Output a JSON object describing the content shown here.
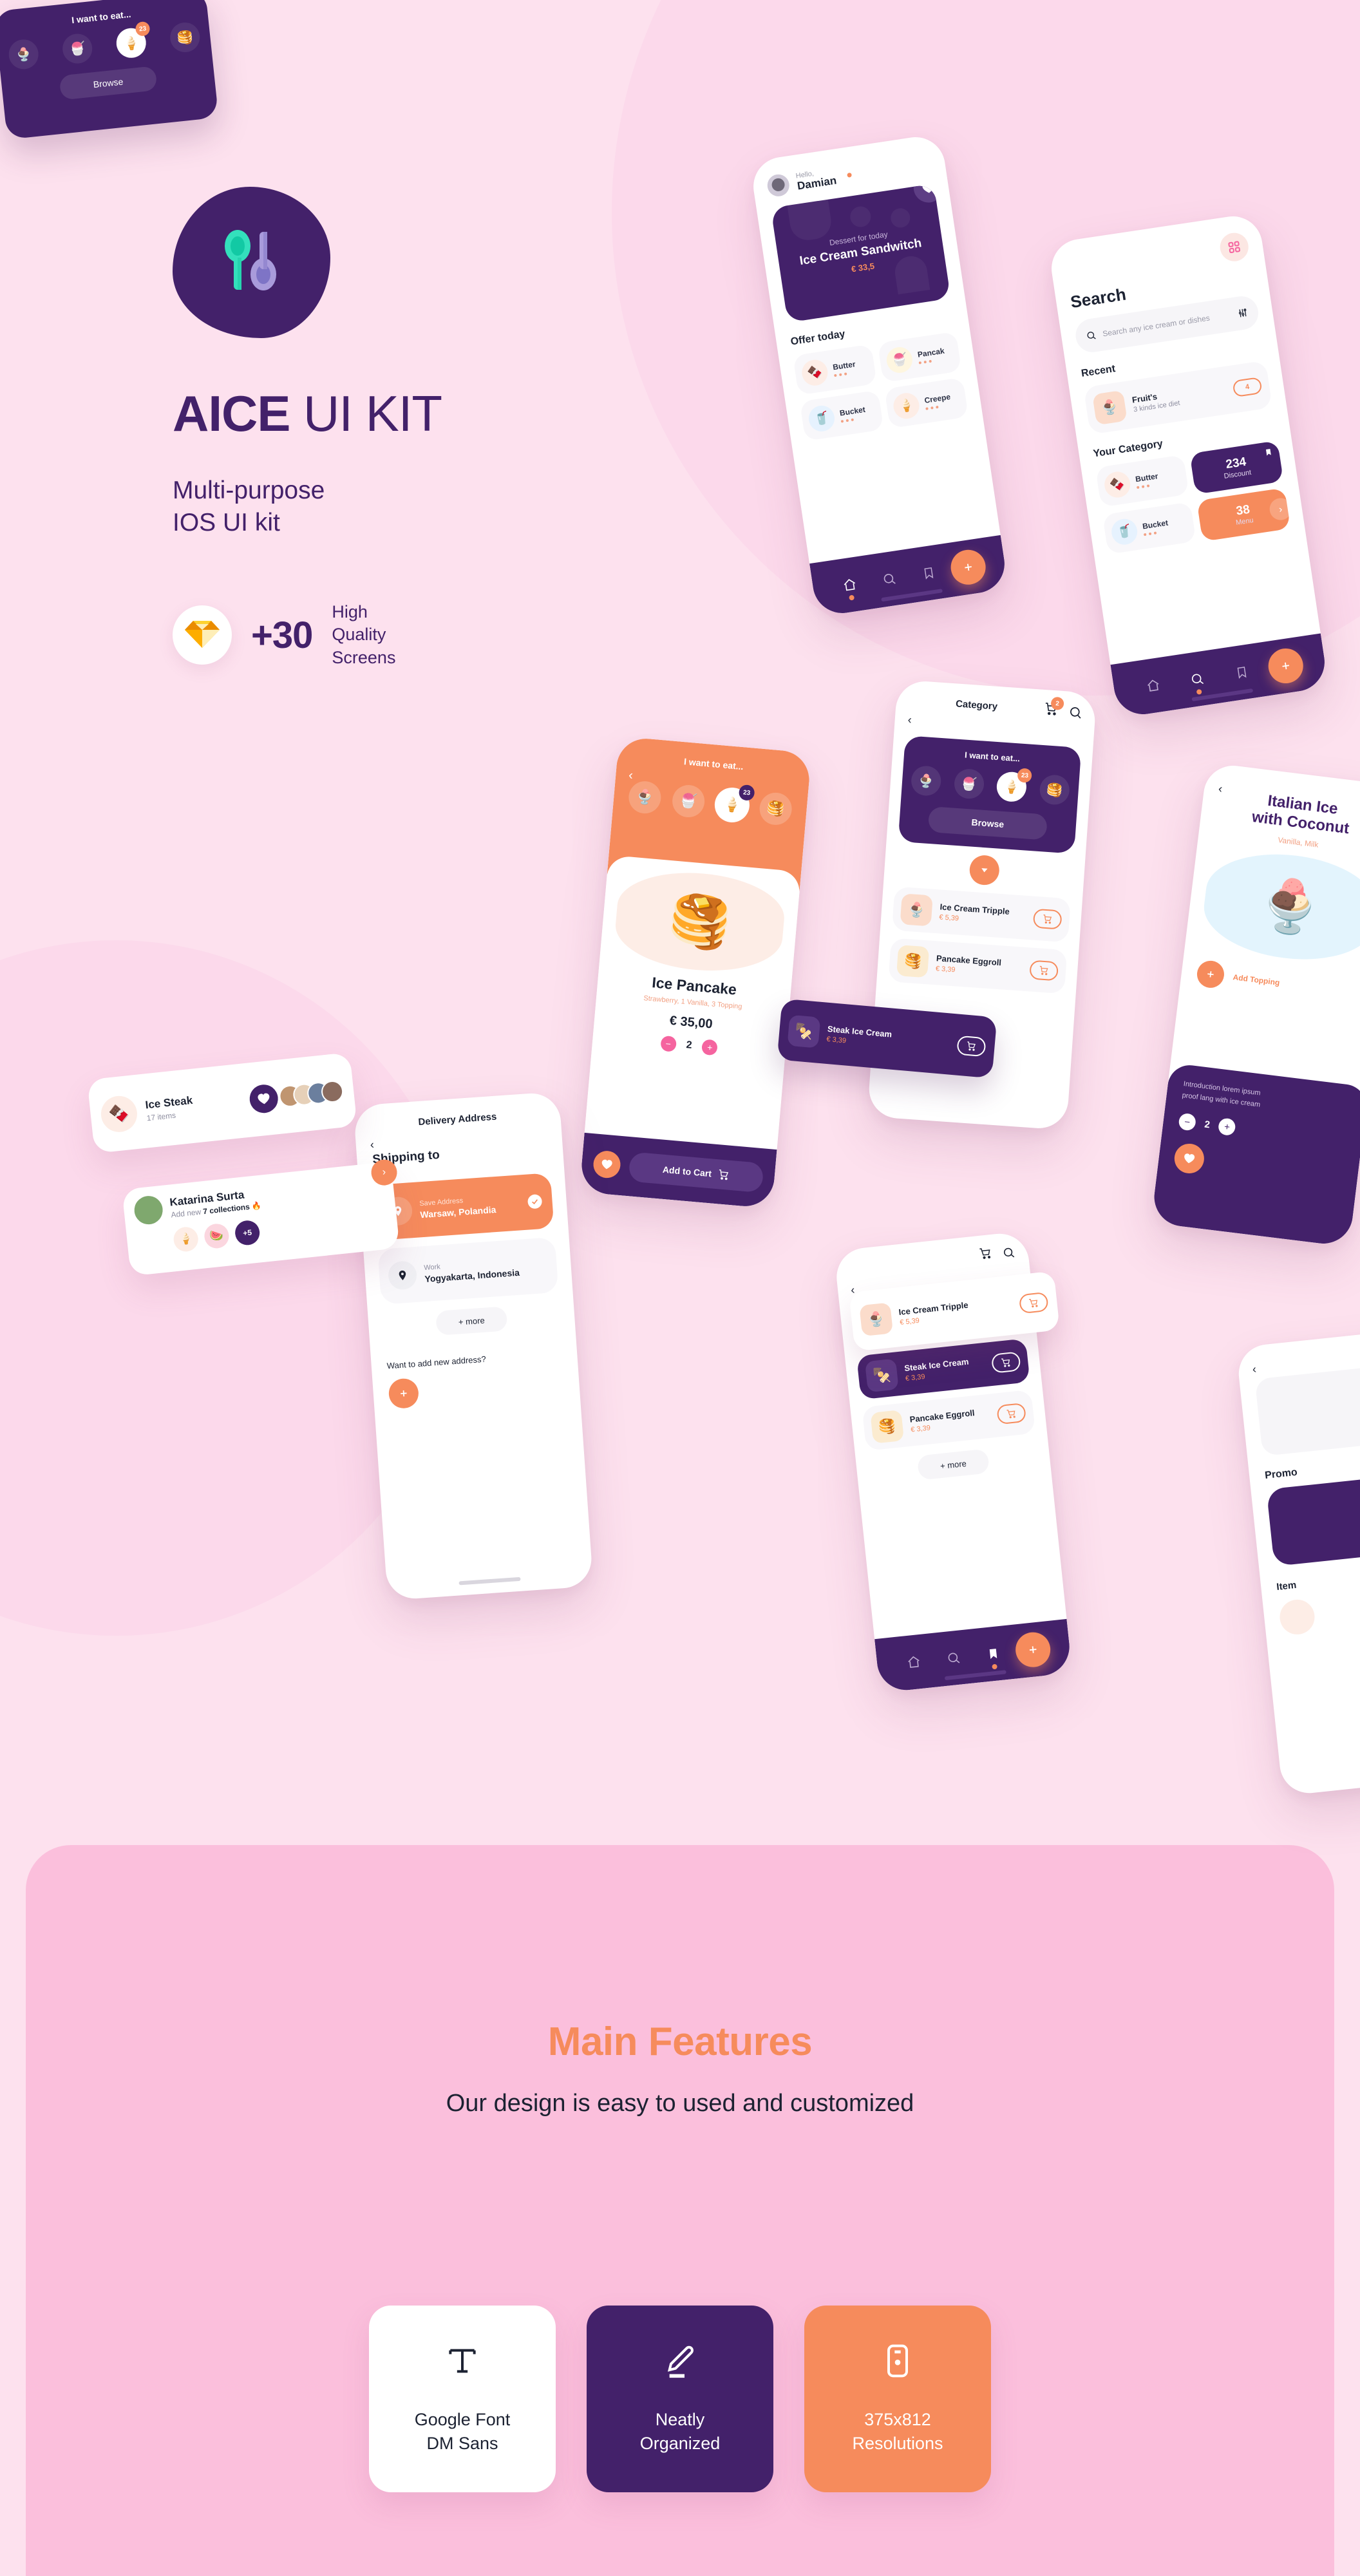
{
  "brand": {
    "title_bold": "AICE",
    "title_rest": " UI KIT",
    "subtitle_line1": "Multi-purpose",
    "subtitle_line2": "IOS UI kit",
    "count": "+30",
    "count_caption_line1": "High",
    "count_caption_line2": "Quality",
    "count_caption_line3": "Screens",
    "logo_icon": "two-spoons-icon",
    "sketch_icon": "sketch-diamond-icon",
    "colors": {
      "purple": "#43216A",
      "orange": "#F68B5C",
      "pink_bg": "#FDE1EE",
      "pink_panel": "#FBBFDC",
      "dark_text": "#1C2232"
    }
  },
  "home_screen": {
    "greeting": "Hello,",
    "user_name": "Damian",
    "hero_label": "Dessert for today",
    "hero_name": "Ice Cream Sandwitch",
    "hero_price": "€ 33,5",
    "section_title": "Offer today",
    "offers": [
      {
        "name": "Butter",
        "emoji": "🍫"
      },
      {
        "name": "Pancak",
        "emoji": "🍧"
      },
      {
        "name": "Bucket",
        "emoji": "🥤"
      },
      {
        "name": "Creepe",
        "emoji": "🍦"
      }
    ],
    "nav": [
      "home-icon",
      "search-icon",
      "bookmark-icon",
      "add-fab-icon"
    ]
  },
  "search_screen": {
    "title": "Search",
    "placeholder": "Search any ice cream or dishes",
    "recent_title": "Recent",
    "recent_item": {
      "name": "Fruit's",
      "desc": "3 kinds ice diet",
      "count": "4",
      "emoji": "🍨"
    },
    "category_title": "Your Category",
    "categories": [
      {
        "name": "Butter",
        "emoji": "🍫"
      },
      {
        "name": "Bucket",
        "emoji": "🥤"
      }
    ],
    "stats": [
      {
        "num": "234",
        "label": "Discount"
      },
      {
        "num": "38",
        "label": "Menu"
      }
    ]
  },
  "detail_screen": {
    "header": "I want to eat...",
    "chips": [
      "🍨",
      "🍧",
      "🍦",
      "🥞"
    ],
    "chip_badge": "23",
    "product_name": "Ice Pancake",
    "product_sub": "Strawberry, 1 Vanilla, 3 Topping",
    "price": "€ 35,00",
    "qty": "2",
    "add_to_cart": "Add to Cart"
  },
  "category_screen": {
    "title": "Category",
    "cart_badge": "2",
    "panel_title": "I want to eat...",
    "chip_badge": "23",
    "browse": "Browse",
    "items": [
      {
        "name": "Ice Cream Tripple",
        "price": "€ 5,39",
        "emoji": "🍨"
      },
      {
        "name": "Pancake Eggroll",
        "price": "€ 3,39",
        "emoji": "🥞"
      }
    ]
  },
  "italian_screen": {
    "title_line1": "Italian Ice",
    "title_line2": "with Coconut",
    "subtitle": "Vanilla, Milk",
    "add_topping": "Add Topping",
    "intro_line1": "Introduction lorem ipsum",
    "intro_line2": "proof lang with ice cream",
    "qty": "2"
  },
  "cart_screen": {
    "items": [
      {
        "name": "Ice Cream Tripple",
        "price": "€ 5,39",
        "emoji": "🍨",
        "dark": false
      },
      {
        "name": "Steak Ice Cream",
        "price": "€ 3,39",
        "emoji": "🍢",
        "dark": true
      },
      {
        "name": "Pancake Eggroll",
        "price": "€ 3,39",
        "emoji": "🥞",
        "dark": false
      }
    ],
    "more": "+ more"
  },
  "promo_screen": {
    "promo_label": "Promo",
    "item_label": "Item"
  },
  "delivery_screen": {
    "title": "Delivery Address",
    "shipping_to": "Shipping to",
    "addresses": [
      {
        "label": "Save Address",
        "value": "Warsaw, Polandia",
        "selected": true
      },
      {
        "label": "Work",
        "value": "Yogyakarta, Indonesia",
        "selected": false
      }
    ],
    "more": "+ more",
    "ask_new": "Want to add new address?"
  },
  "float_cards": {
    "ice_steak": {
      "name": "Ice Steak",
      "sub": "17 items",
      "emoji": "🍫"
    },
    "katarina": {
      "name": "Katarina Surta",
      "sub_prefix": "Add new ",
      "sub_bold": "7 collections",
      "sub_suffix": " 🔥",
      "plus": "+5",
      "chips": [
        "🍦",
        "🍉"
      ]
    },
    "want_eat": {
      "title": "I want to eat...",
      "badge": "23",
      "browse": "Browse",
      "chips": [
        "🍨",
        "🍧",
        "🍦",
        "🥞"
      ]
    },
    "pill_steak": {
      "name": "Steak Ice Cream",
      "price": "€ 3,39",
      "emoji": "🍢"
    },
    "pill_tripple": {
      "name": "Ice Cream Tripple",
      "price": "€ 5,39",
      "emoji": "🍨"
    }
  },
  "features": {
    "title": "Main Features",
    "subtitle": "Our design is easy to used and customized",
    "cards": [
      {
        "icon": "text-type-icon",
        "label": "Google Font\nDM Sans",
        "style": "fc-white"
      },
      {
        "icon": "pencil-edit-icon",
        "label": "Neatly\nOrganized",
        "style": "fc-purple"
      },
      {
        "icon": "mobile-device-icon",
        "label": "375x812\nResolutions",
        "style": "fc-orange"
      }
    ]
  }
}
